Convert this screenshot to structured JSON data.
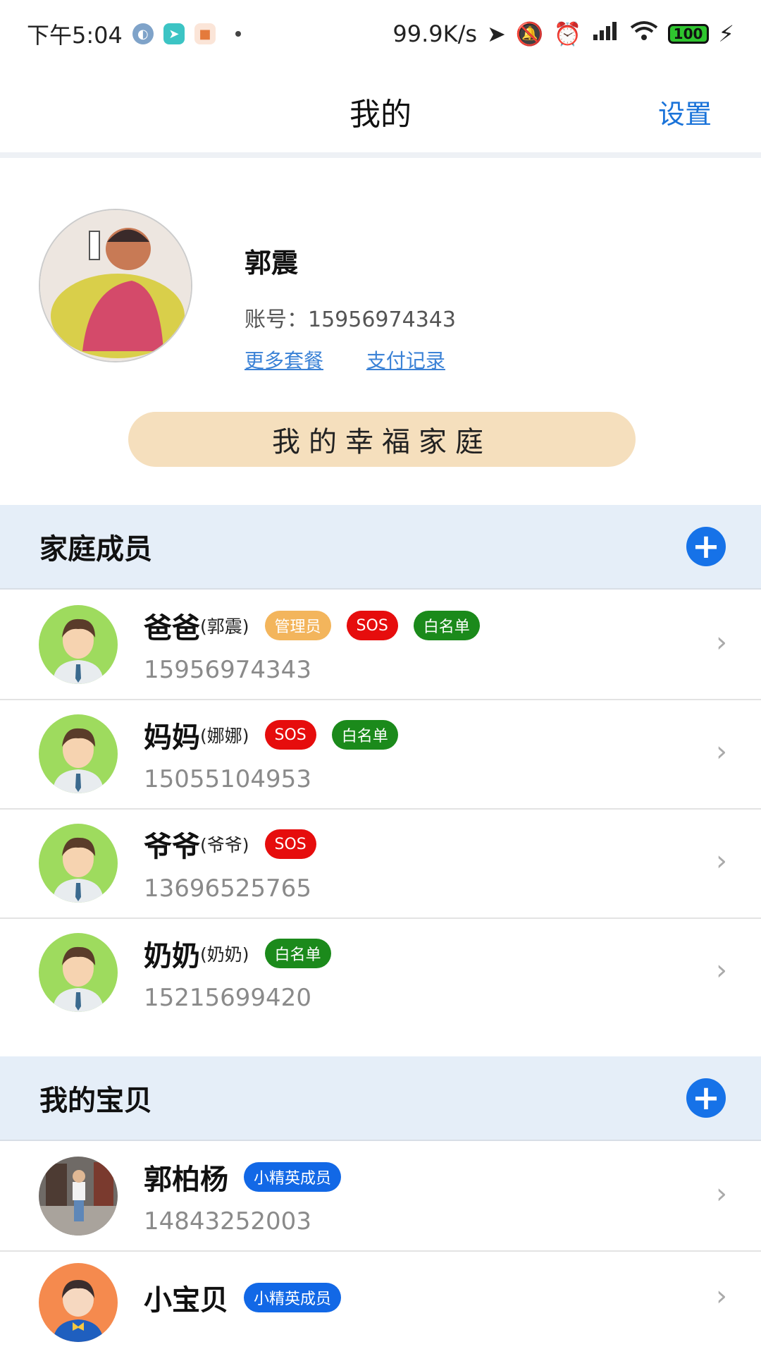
{
  "status_bar": {
    "time": "下午5:04",
    "network_speed": "99.9K/s",
    "battery": "100"
  },
  "header": {
    "title": "我的",
    "settings_label": "设置"
  },
  "profile": {
    "name": "郭震",
    "account_label": "账号：",
    "account": "15956974343",
    "more_plans": "更多套餐",
    "payment_records": "支付记录",
    "family_button": "我的幸福家庭"
  },
  "family_section": {
    "title": "家庭成员",
    "members": [
      {
        "name": "爸爸",
        "nickname": "(郭震)",
        "phone": "15956974343",
        "tags": [
          "管理员",
          "SOS",
          "白名单"
        ]
      },
      {
        "name": "妈妈",
        "nickname": "(娜娜)",
        "phone": "15055104953",
        "tags": [
          "SOS",
          "白名单"
        ]
      },
      {
        "name": "爷爷",
        "nickname": "(爷爷)",
        "phone": "13696525765",
        "tags": [
          "SOS"
        ]
      },
      {
        "name": "奶奶",
        "nickname": "(奶奶)",
        "phone": "15215699420",
        "tags": [
          "白名单"
        ]
      }
    ]
  },
  "baby_section": {
    "title": "我的宝贝",
    "babies": [
      {
        "name": "郭柏杨",
        "tag": "小精英成员",
        "phone": "14843252003"
      },
      {
        "name": "小宝贝",
        "tag": "小精英成员"
      }
    ]
  },
  "colors": {
    "accent": "#1672e8",
    "admin_tag": "#f3b55c",
    "sos_tag": "#e60d0d",
    "whitelist_tag": "#1b8a1b",
    "elite_tag": "#1268e6",
    "section_bg": "#e5eef8",
    "family_button_bg": "#f5dfbd"
  }
}
